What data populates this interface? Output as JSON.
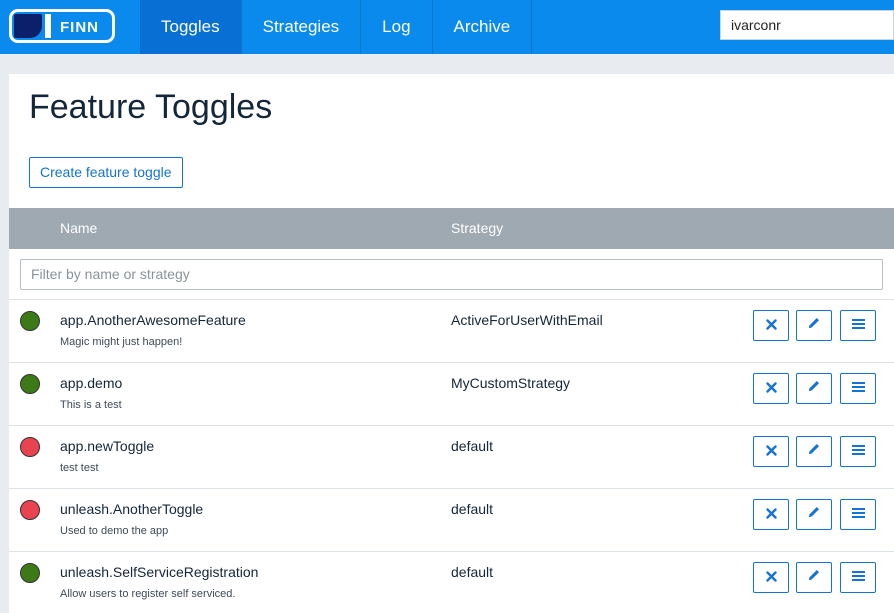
{
  "app": {
    "logo_text": "FINN",
    "brand_color": "#0a8aec"
  },
  "nav": {
    "tabs": [
      {
        "label": "Toggles",
        "active": true
      },
      {
        "label": "Strategies",
        "active": false
      },
      {
        "label": "Log",
        "active": false
      },
      {
        "label": "Archive",
        "active": false
      }
    ]
  },
  "user": {
    "name": "ivarconr"
  },
  "page": {
    "title": "Feature Toggles",
    "create_label": "Create feature toggle"
  },
  "table": {
    "columns": {
      "name": "Name",
      "strategy": "Strategy"
    },
    "filter_placeholder": "Filter by name or strategy",
    "rows": [
      {
        "name": "app.AnotherAwesomeFeature",
        "description": "Magic might just happen!",
        "strategy": "ActiveForUserWithEmail",
        "enabled": true
      },
      {
        "name": "app.demo",
        "description": "This is a test",
        "strategy": "MyCustomStrategy",
        "enabled": true
      },
      {
        "name": "app.newToggle",
        "description": "test test",
        "strategy": "default",
        "enabled": false
      },
      {
        "name": "unleash.AnotherToggle",
        "description": "Used to demo the app",
        "strategy": "default",
        "enabled": false
      },
      {
        "name": "unleash.SelfServiceRegistration",
        "description": "Allow users to register self serviced.",
        "strategy": "default",
        "enabled": true
      }
    ],
    "status_colors": {
      "on": "#3c7a16",
      "off": "#e8434f"
    },
    "row_actions": [
      "close-icon",
      "pencil-icon",
      "list-icon"
    ]
  }
}
